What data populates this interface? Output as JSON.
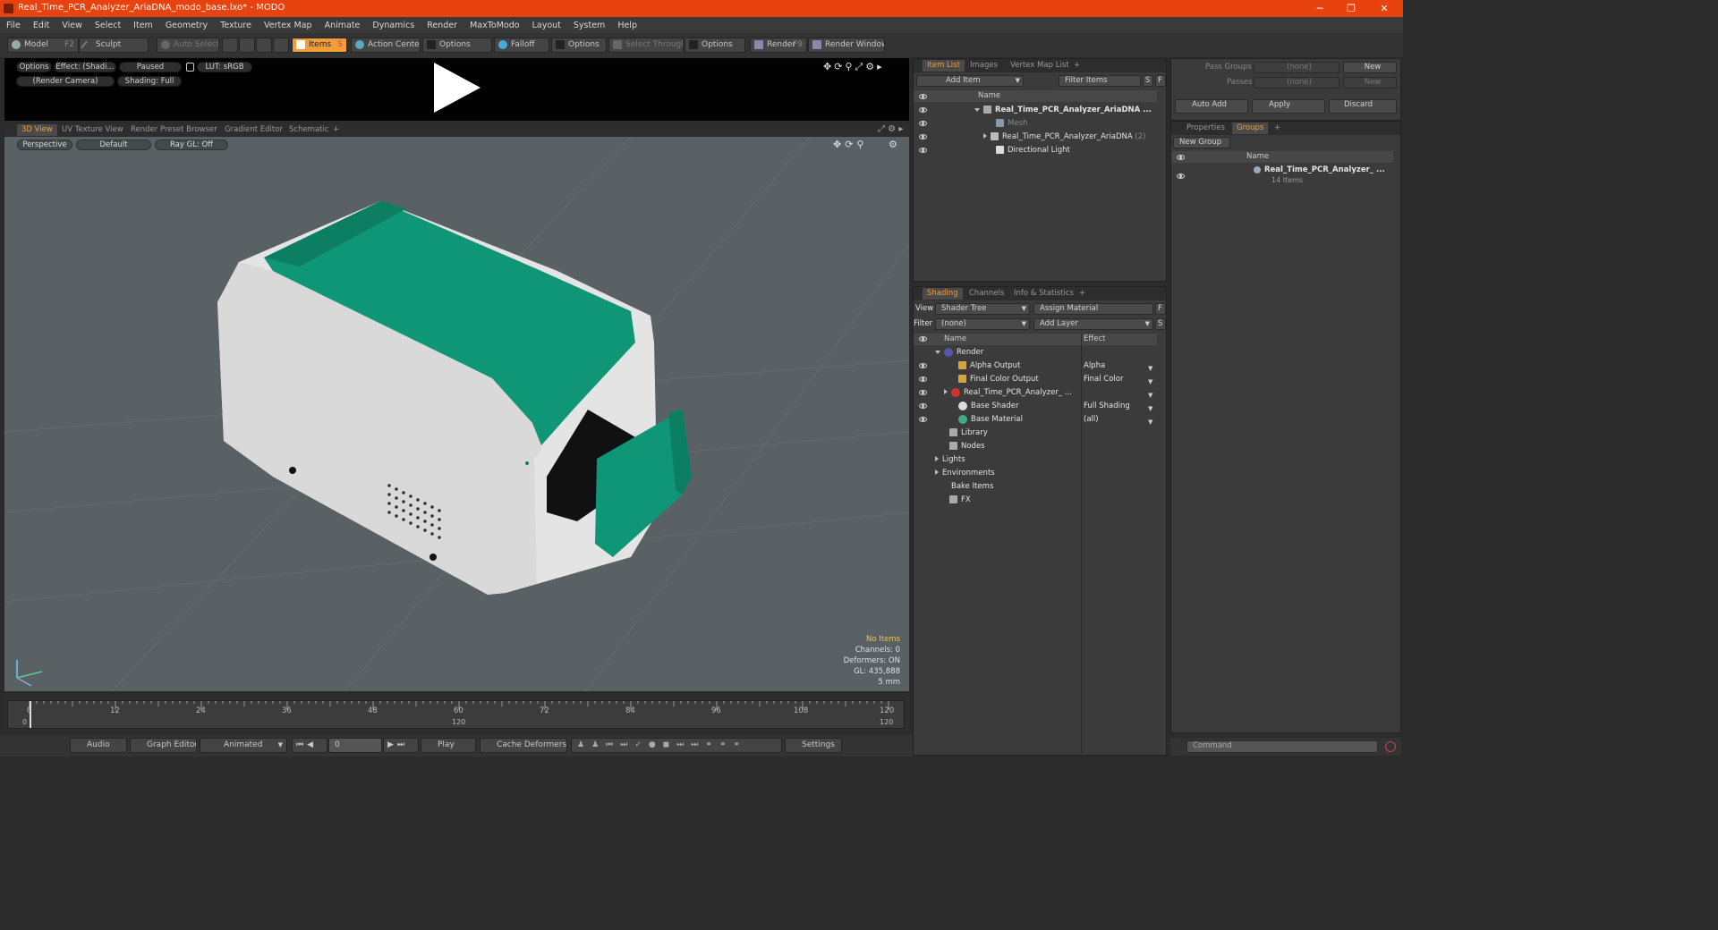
{
  "window": {
    "title": "Real_Time_PCR_Analyzer_AriaDNA_modo_base.lxo* - MODO",
    "min": "─",
    "max": "❐",
    "close": "✕"
  },
  "menu": [
    "File",
    "Edit",
    "View",
    "Select",
    "Item",
    "Geometry",
    "Texture",
    "Vertex Map",
    "Animate",
    "Dynamics",
    "Render",
    "MaxToModo",
    "Layout",
    "System",
    "Help"
  ],
  "toolbar": {
    "model": "Model",
    "model_key": "F2",
    "sculpt": "Sculpt",
    "auto_select": "Auto Select",
    "items": "Items",
    "items_key": "S",
    "action_center": "Action Center",
    "options1": "Options",
    "falloff": "Falloff",
    "options2": "Options",
    "select_through": "Select Through",
    "options3": "Options",
    "render": "Render",
    "render_key": "F9",
    "render_window": "Render Window"
  },
  "preview": {
    "options": "Options",
    "effect": "Effect: (Shadi...",
    "paused": "Paused",
    "lut": "LUT: sRGB",
    "camera": "(Render Camera)",
    "shading": "Shading: Full"
  },
  "viewtabs": [
    "3D View",
    "UV Texture View",
    "Render Preset Browser",
    "Gradient Editor",
    "Schematic",
    "+"
  ],
  "viewport": {
    "perspective": "Perspective",
    "default": "Default",
    "raygl": "Ray GL: Off",
    "stats": {
      "items": "No Items",
      "channels": "Channels: 0",
      "deformers": "Deformers: ON",
      "gl": "GL: 435,888",
      "unit": "5 mm"
    },
    "colors": {
      "body": "#e8e8e8",
      "lid": "#0f9676",
      "bg": "#5a6165"
    }
  },
  "timeline": {
    "ticks": [
      "0",
      "12",
      "24",
      "36",
      "48",
      "60",
      "72",
      "84",
      "96",
      "108",
      "120"
    ],
    "mid": "120",
    "left": "0",
    "right": "120"
  },
  "bottom": {
    "audio": "Audio",
    "graph": "Graph Editor",
    "animated": "Animated",
    "frame": "0",
    "play": "Play",
    "cache": "Cache Deformers",
    "settings": "Settings"
  },
  "itemlist": {
    "tabs": [
      "Item List",
      "Images",
      "Vertex Map List",
      "+"
    ],
    "add_item": "Add Item",
    "filter": "Filter Items",
    "s": "S",
    "f": "F",
    "col_name": "Name",
    "rows": [
      {
        "label": "Real_Time_PCR_Analyzer_AriaDNA ...",
        "indent": 0
      },
      {
        "label": "Mesh",
        "indent": 1
      },
      {
        "label": "Real_Time_PCR_Analyzer_AriaDNA",
        "suffix": "(2)",
        "indent": 1
      },
      {
        "label": "Directional Light",
        "indent": 1
      }
    ]
  },
  "shading": {
    "tabs": [
      "Shading",
      "Channels",
      "Info & Statistics",
      "+"
    ],
    "view_label": "View",
    "view_value": "Shader Tree",
    "assign": "Assign Material",
    "f": "F",
    "filter_label": "Filter",
    "filter_value": "(none)",
    "add_layer": "Add Layer",
    "s": "S",
    "col_name": "Name",
    "col_effect": "Effect",
    "rows": [
      {
        "name": "Render",
        "effect": ""
      },
      {
        "name": "Alpha Output",
        "effect": "Alpha"
      },
      {
        "name": "Final Color Output",
        "effect": "Final Color"
      },
      {
        "name": "Real_Time_PCR_Analyzer_ ...",
        "effect": ""
      },
      {
        "name": "Base Shader",
        "effect": "Full Shading"
      },
      {
        "name": "Base Material",
        "effect": "(all)"
      },
      {
        "name": "Library",
        "effect": ""
      },
      {
        "name": "Nodes",
        "effect": ""
      },
      {
        "name": "Lights",
        "effect": ""
      },
      {
        "name": "Environments",
        "effect": ""
      },
      {
        "name": "Bake Items",
        "effect": ""
      },
      {
        "name": "FX",
        "effect": ""
      }
    ]
  },
  "groups": {
    "pass_groups": "Pass Groups",
    "pass_value": "(none)",
    "new1": "New",
    "passes": "Passes",
    "passes_value": "(none)",
    "new2": "New",
    "auto_add": "Auto Add",
    "apply": "Apply",
    "discard": "Discard",
    "tabs": [
      "Properties",
      "Groups",
      "+"
    ],
    "new_group": "New Group",
    "col_name": "Name",
    "item": "Real_Time_PCR_Analyzer_ ...",
    "count": "14 Items",
    "command": "Command"
  }
}
